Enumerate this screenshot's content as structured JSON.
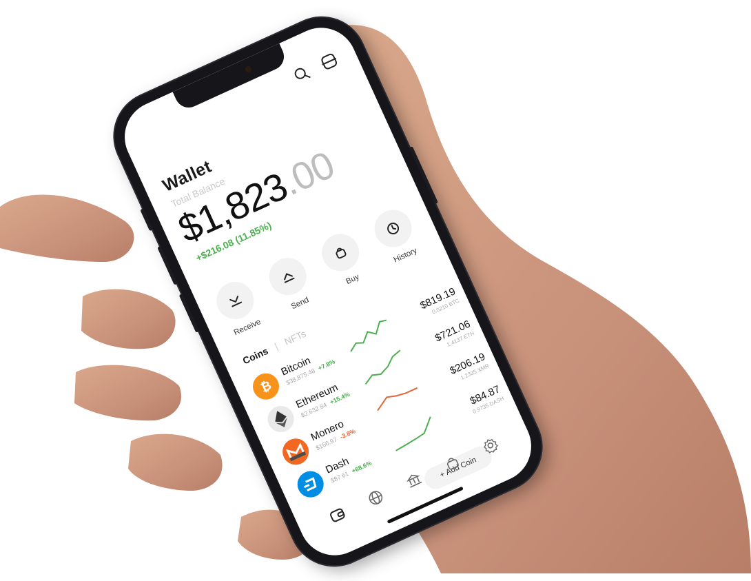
{
  "app": {
    "title": "Wallet",
    "subtitle": "Total Balance",
    "balance_int": "$1,823",
    "balance_dec": ".00",
    "gain": "+$216.08 (11.85%)"
  },
  "header_icons": [
    "search-icon",
    "scan-icon"
  ],
  "actions": [
    {
      "label": "Receive",
      "icon": "receive-icon"
    },
    {
      "label": "Send",
      "icon": "send-icon"
    },
    {
      "label": "Buy",
      "icon": "bag-icon"
    },
    {
      "label": "History",
      "icon": "clock-icon"
    }
  ],
  "tabs": {
    "active": "Coins",
    "inactive": "NFTs"
  },
  "coins": [
    {
      "name": "Bitcoin",
      "price": "$38,875.48",
      "change": "+7.8%",
      "value_usd": "$819.19",
      "amount": "0.0210 BTC",
      "color": "#f7931a",
      "trend_up": true
    },
    {
      "name": "Ethereum",
      "price": "$2,632.84",
      "change": "+15.4%",
      "value_usd": "$721.06",
      "amount": "1.4137 ETH",
      "color": "#e9e9e9",
      "trend_up": true
    },
    {
      "name": "Monero",
      "price": "$166.97",
      "change": "-3.8%",
      "value_usd": "$206.19",
      "amount": "1.2335 XMR",
      "color": "#f26822",
      "trend_up": false
    },
    {
      "name": "Dash",
      "price": "$87.61",
      "change": "+68.6%",
      "value_usd": "$84.87",
      "amount": "0.9735 DASH",
      "color": "#008de4",
      "trend_up": true
    }
  ],
  "add_coin": "+ Add Coin",
  "bottom_nav": [
    "wallet-icon",
    "globe-icon",
    "bank-icon",
    "bag-icon",
    "gear-icon"
  ],
  "colors": {
    "positive": "#4caf50",
    "negative": "#e0663a",
    "phone_frame": "#15151a"
  }
}
